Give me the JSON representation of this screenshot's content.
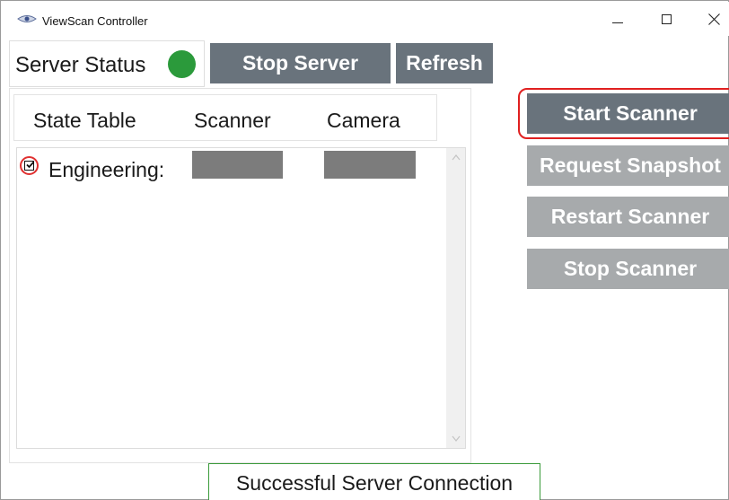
{
  "window": {
    "title": "ViewScan Controller",
    "icon": "viewscan-eye-icon",
    "controls": [
      "minimize-icon",
      "maximize-icon",
      "close-icon"
    ]
  },
  "server": {
    "status_label": "Server Status",
    "status_color": "#2b9a3b",
    "stop_label": "Stop Server",
    "refresh_label": "Refresh"
  },
  "table": {
    "headers": [
      "State Table",
      "Scanner",
      "Camera"
    ],
    "rows": [
      {
        "label": "Engineering:",
        "checked": true,
        "scanner_color": "#7c7c7c",
        "camera_color": "#7c7c7c"
      }
    ]
  },
  "actions": {
    "start_scanner": "Start Scanner",
    "request_snapshot": "Request Snapshot",
    "restart_scanner": "Restart Scanner",
    "stop_scanner": "Stop Scanner"
  },
  "colors": {
    "button_active": "#69737c",
    "button_disabled": "#a7aaac",
    "highlight": "#e02020",
    "status_border": "#3a9a3a"
  },
  "message": "Successful Server Connection"
}
